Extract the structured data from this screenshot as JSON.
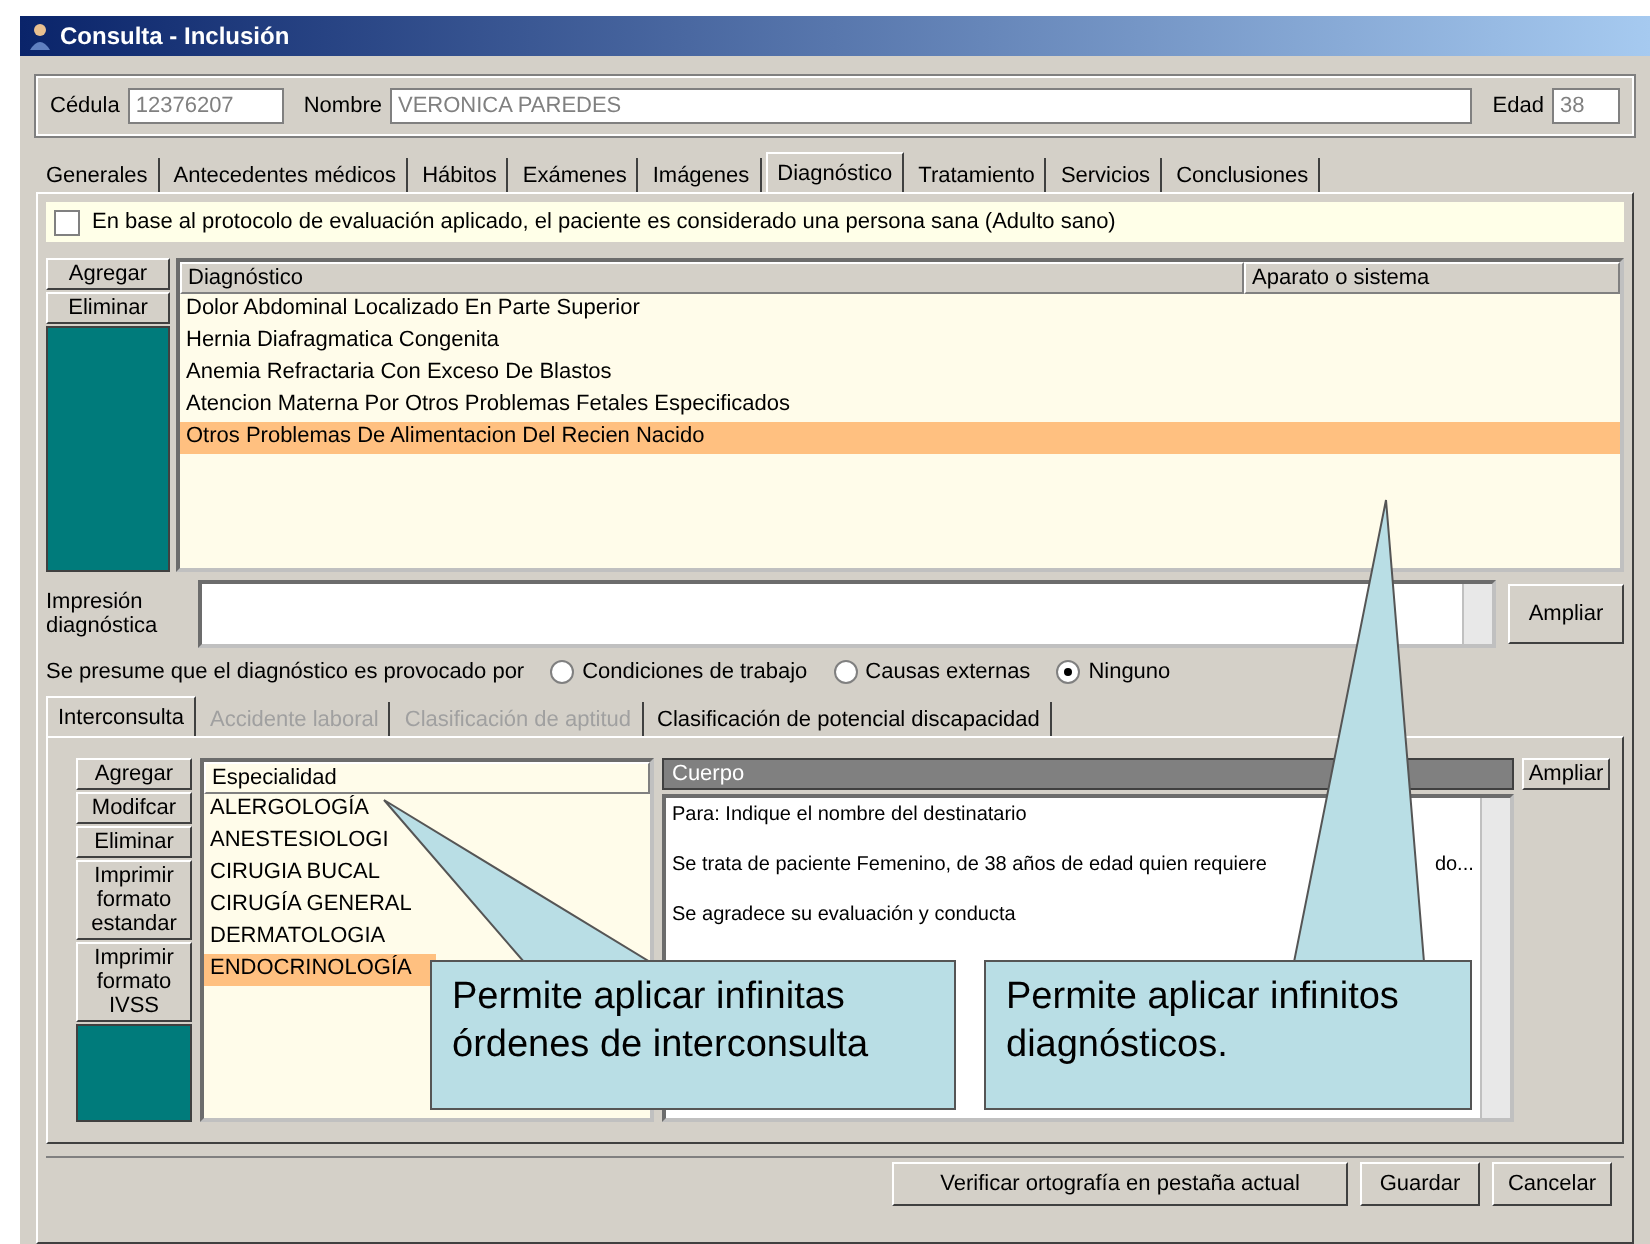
{
  "window": {
    "title": "Consulta - Inclusión"
  },
  "patient": {
    "cedula_label": "Cédula",
    "cedula": "12376207",
    "nombre_label": "Nombre",
    "nombre": "VERONICA PAREDES",
    "edad_label": "Edad",
    "edad": "38"
  },
  "tabs": [
    {
      "label": "Generales",
      "selected": false
    },
    {
      "label": "Antecedentes médicos",
      "selected": false
    },
    {
      "label": "Hábitos",
      "selected": false
    },
    {
      "label": "Exámenes",
      "selected": false
    },
    {
      "label": "Imágenes",
      "selected": false
    },
    {
      "label": "Diagnóstico",
      "selected": true
    },
    {
      "label": "Tratamiento",
      "selected": false
    },
    {
      "label": "Servicios",
      "selected": false
    },
    {
      "label": "Conclusiones",
      "selected": false
    }
  ],
  "healthy_check": {
    "label": "En base al protocolo de evaluación aplicado, el paciente es considerado una persona sana (Adulto sano)",
    "checked": false
  },
  "diagnosis": {
    "buttons": [
      "Agregar",
      "Eliminar"
    ],
    "columns": [
      "Diagnóstico",
      "Aparato o sistema"
    ],
    "rows": [
      {
        "text": "Dolor Abdominal Localizado En Parte Superior",
        "selected": false
      },
      {
        "text": "Hernia Diafragmatica Congenita",
        "selected": false
      },
      {
        "text": "Anemia Refractaria Con Exceso De Blastos",
        "selected": false
      },
      {
        "text": "Atencion Materna Por Otros Problemas Fetales Especificados",
        "selected": false
      },
      {
        "text": "Otros Problemas De Alimentacion Del Recien Nacido",
        "selected": true
      }
    ]
  },
  "impression": {
    "label": "Impresión diagnóstica",
    "button": "Ampliar"
  },
  "cause": {
    "label": "Se presume que el diagnóstico es provocado por",
    "options": [
      {
        "label": "Condiciones de trabajo",
        "selected": false
      },
      {
        "label": "Causas externas",
        "selected": false
      },
      {
        "label": "Ninguno",
        "selected": true
      }
    ]
  },
  "subtabs": [
    {
      "label": "Interconsulta",
      "selected": true,
      "disabled": false
    },
    {
      "label": "Accidente laboral",
      "selected": false,
      "disabled": true
    },
    {
      "label": "Clasificación de aptitud",
      "selected": false,
      "disabled": true
    },
    {
      "label": "Clasificación de potencial discapacidad",
      "selected": false,
      "disabled": false
    }
  ],
  "interconsulta": {
    "buttons": [
      "Agregar",
      "Modifcar",
      "Eliminar",
      "Imprimir formato estandar",
      "Imprimir formato IVSS"
    ],
    "column": "Especialidad",
    "rows": [
      {
        "text": "ALERGOLOGÍA",
        "selected": false
      },
      {
        "text": "ANESTESIOLOGI",
        "selected": false
      },
      {
        "text": "CIRUGIA BUCAL",
        "selected": false
      },
      {
        "text": "CIRUGÍA GENERAL",
        "selected": false
      },
      {
        "text": "DERMATOLOGIA",
        "selected": false
      },
      {
        "text": "ENDOCRINOLOGÍA",
        "selected": true
      }
    ],
    "body_header": "Cuerpo",
    "body_button": "Ampliar",
    "body_lines": [
      [
        "Para: Indique el nombre del destinatario"
      ],
      [
        "Se trata de paciente Femenino, de 38 años de edad quien requiere",
        "do..."
      ],
      [
        "Se agradece su evaluación y conducta"
      ]
    ]
  },
  "footer_buttons": [
    "Verificar ortografía en pestaña actual",
    "Guardar",
    "Cancelar"
  ],
  "callouts": [
    {
      "text": "Permite aplicar infinitas órdenes de interconsulta"
    },
    {
      "text": "Permite aplicar infinitos diagnósticos."
    }
  ]
}
